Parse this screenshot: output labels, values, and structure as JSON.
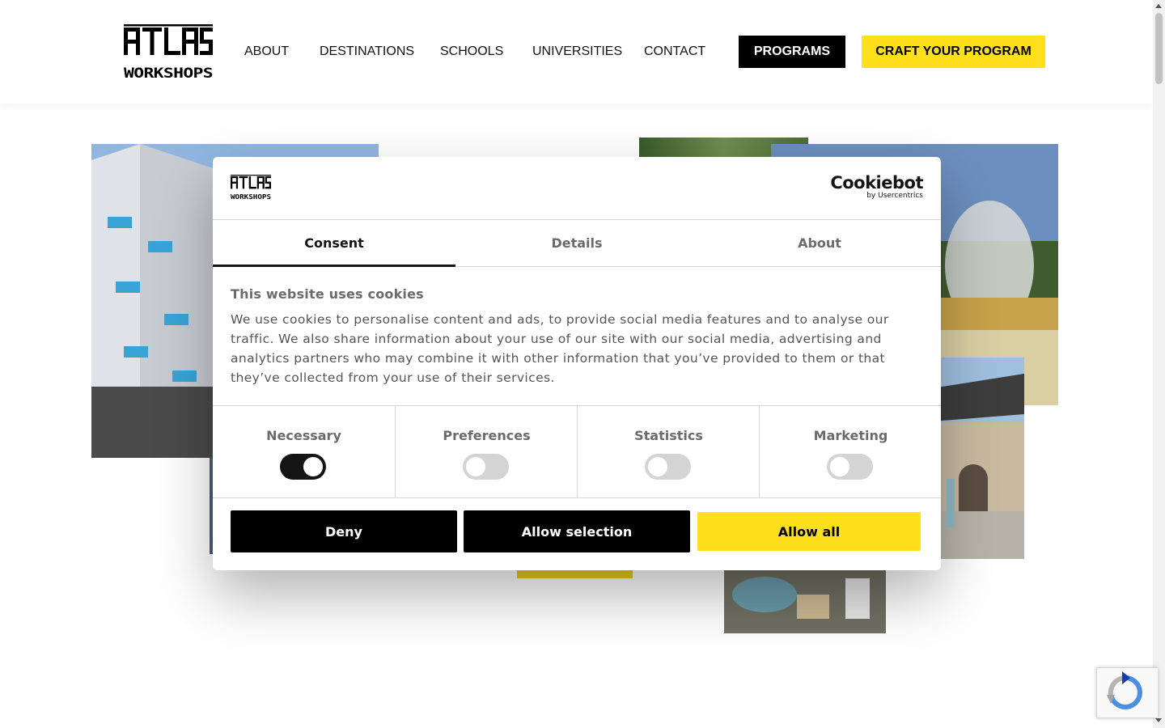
{
  "header": {
    "logo_text_top": "ATLAS",
    "logo_text_bottom": "WORKSHOPS",
    "nav": [
      "ABOUT",
      "DESTINATIONS",
      "SCHOOLS",
      "UNIVERSITIES",
      "CONTACT"
    ],
    "programs_label": "PROGRAMS",
    "craft_label": "CRAFT YOUR PROGRAM"
  },
  "cookie_dialog": {
    "brand_main": "Cookiebot",
    "brand_sub": "by Usercentrics",
    "tabs": [
      "Consent",
      "Details",
      "About"
    ],
    "active_tab": "Consent",
    "title": "This website uses cookies",
    "text": "We use cookies to personalise content and ads, to provide social media features and to analyse our traffic. We also share information about your use of our site with our social media, advertising and analytics partners who may combine it with other information that you’ve provided to them or that they’ve collected from your use of their services.",
    "toggles": [
      {
        "label": "Necessary",
        "on": true
      },
      {
        "label": "Preferences",
        "on": false
      },
      {
        "label": "Statistics",
        "on": false
      },
      {
        "label": "Marketing",
        "on": false
      }
    ],
    "buttons": {
      "deny": "Deny",
      "allow_selection": "Allow selection",
      "allow_all": "Allow all"
    }
  },
  "colors": {
    "accent": "#ffe01b",
    "dark": "#000000"
  }
}
